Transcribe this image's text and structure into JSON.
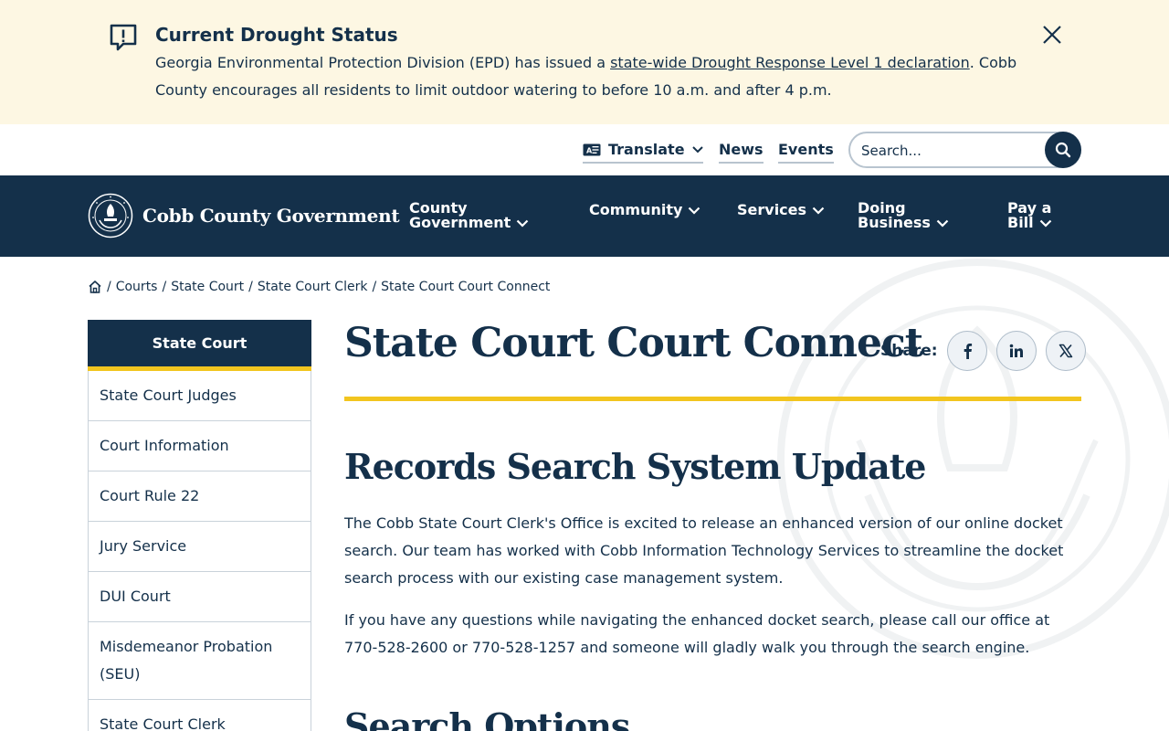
{
  "alert": {
    "title": "Current Drought Status",
    "text_before": "Georgia Environmental Protection Division (EPD) has issued a ",
    "link": "state-wide Drought Response Level 1 declaration",
    "text_after": ". Cobb County encourages all residents to limit outdoor watering to before 10 a.m. and after 4 p.m.",
    "icon": "alert-bubble-icon",
    "close_icon": "close-icon"
  },
  "utility": {
    "translate": "Translate",
    "news": "News",
    "events": "Events",
    "search_placeholder": "Search..."
  },
  "logo": {
    "text": "Cobb County Government"
  },
  "nav": {
    "items": [
      {
        "label_line1": "County",
        "label_line2": "Government"
      },
      {
        "label_line1": "Community",
        "label_line2": ""
      },
      {
        "label_line1": "Services",
        "label_line2": ""
      },
      {
        "label_line1": "Doing",
        "label_line2": "Business"
      },
      {
        "label_line1": "Pay a",
        "label_line2": "Bill"
      }
    ]
  },
  "breadcrumb": {
    "items": [
      "Courts",
      "State Court",
      "State Court Clerk",
      "State Court Court Connect"
    ],
    "separator": "/"
  },
  "sidebar": {
    "heading": "State Court",
    "items": [
      "State Court Judges",
      "Court Information",
      "Court Rule 22",
      "Jury Service",
      "DUI Court",
      "Misdemeanor Probation (SEU)",
      "State Court Clerk"
    ]
  },
  "page": {
    "title": "State Court Court Connect",
    "share_label": "Share:",
    "share_icons": [
      "facebook-icon",
      "linkedin-icon",
      "x-icon"
    ],
    "section1_heading": "Records Search System Update",
    "para1": "The Cobb State Court Clerk's Office is excited to release an enhanced version of our online docket search. Our team has worked with Cobb Information Technology Services to streamline the docket search process with our existing case management system.",
    "para2": "If you have any questions while navigating the enhanced docket search, please call our office at 770-528-2600 or 770-528-1257 and someone will gladly walk you through the search engine.",
    "section2_heading": "Search Options"
  },
  "colors": {
    "navy": "#14304a",
    "gold": "#f2c51f",
    "alert_bg": "#fdf7e3"
  }
}
